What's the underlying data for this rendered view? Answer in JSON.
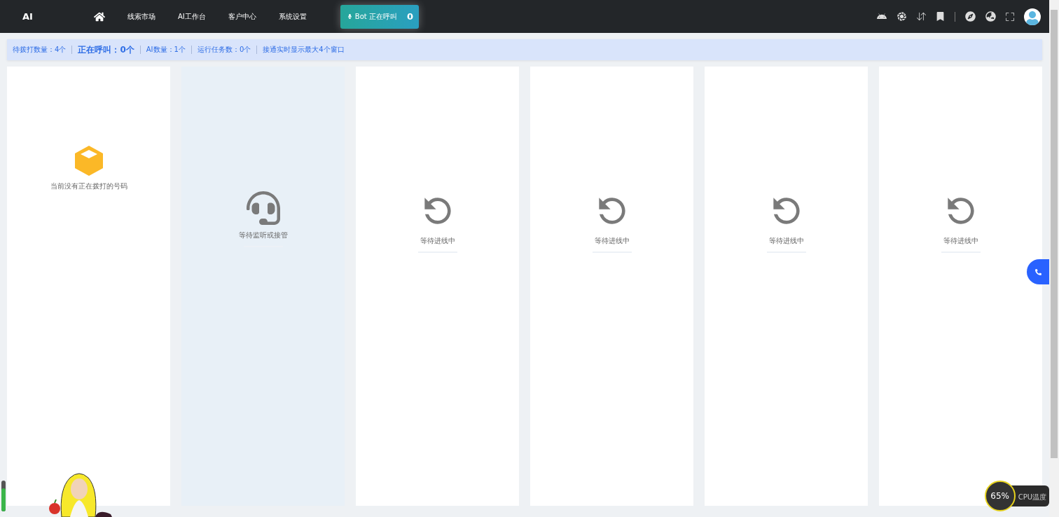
{
  "topbar": {
    "logo": "AI",
    "nav": [
      "线索市场",
      "AI工作台",
      "客户中心",
      "系统设置"
    ],
    "call_button": {
      "label": "Bot 正在呼叫",
      "count": "0"
    }
  },
  "stats": [
    {
      "label": "待拨打数量：4个",
      "emphasis": false
    },
    {
      "label": "正在呼叫：0个",
      "emphasis": true
    },
    {
      "label": "AI数量：1个",
      "emphasis": false
    },
    {
      "label": "运行任务数：0个",
      "emphasis": false
    },
    {
      "label": "接通实时显示最大4个窗口",
      "emphasis": false
    }
  ],
  "panels": [
    {
      "kind": "empty",
      "text": "当前没有正在拨打的号码",
      "selected": false
    },
    {
      "kind": "headset",
      "text": "等待监听或接管",
      "selected": true
    },
    {
      "kind": "waiting",
      "text": "等待进线中",
      "selected": false
    },
    {
      "kind": "waiting",
      "text": "等待进线中",
      "selected": false
    },
    {
      "kind": "waiting",
      "text": "等待进线中",
      "selected": false
    },
    {
      "kind": "waiting",
      "text": "等待进线中",
      "selected": false
    }
  ],
  "cpu_widget": {
    "usage": "65%",
    "label": "CPU温度"
  }
}
